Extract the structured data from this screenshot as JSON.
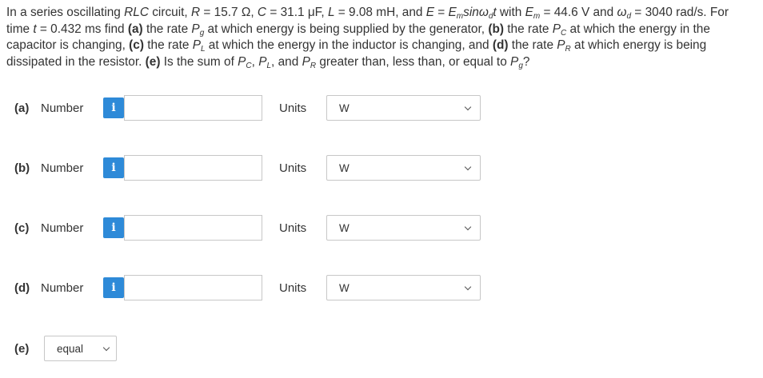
{
  "question": {
    "p1": "In a series oscillating ",
    "rlc": "RLC",
    "p2": " circuit, ",
    "R": "R",
    "p3": " = 15.7 Ω, ",
    "C": "C",
    "p4": " = 31.1 μF, ",
    "L": "L",
    "p5": " = 9.08 mH, and ",
    "E": "E",
    "p6": " = ",
    "Em": "E",
    "Em_sub": "m",
    "sin": "sinω",
    "sin_sub": "d",
    "t1": "t",
    "p7": " with ",
    "Em2": "E",
    "Em2_sub": "m",
    "p8": " = 44.6 V and ",
    "wd": "ω",
    "wd_sub": "d",
    "p9": " = 3040 rad/s. For time ",
    "t2": "t",
    "p10": " = 0.432 ms find ",
    "a": "(a)",
    "p11": " the rate ",
    "Pg": "P",
    "Pg_sub": "g",
    "p12": " at which energy is being supplied by the generator, ",
    "b": "(b)",
    "p13": " the rate ",
    "Pc": "P",
    "Pc_sub": "C",
    "p14": " at which the energy in the capacitor is changing, ",
    "c": "(c)",
    "p15": " the rate ",
    "Pl": "P",
    "Pl_sub": "L",
    "p16": " at which the energy in the inductor is changing, and ",
    "d": "(d)",
    "p17": " the rate ",
    "Pr": "P",
    "Pr_sub": "R",
    "p18": " at which energy is being dissipated in the resistor. ",
    "e": "(e)",
    "p19": " Is the sum of ",
    "Pc2": "P",
    "Pc2_sub": "C",
    "p20": ", ",
    "Pl2": "P",
    "Pl2_sub": "L",
    "p21": ", and ",
    "Pr2": "P",
    "Pr2_sub": "R",
    "p22": " greater than, less than, or equal to ",
    "Pg2": "P",
    "Pg2_sub": "g",
    "p23": "?"
  },
  "parts": [
    {
      "label": "(a)",
      "number_label": "Number",
      "info_icon": "i",
      "value": "",
      "units_label": "Units",
      "units_value": "W"
    },
    {
      "label": "(b)",
      "number_label": "Number",
      "info_icon": "i",
      "value": "",
      "units_label": "Units",
      "units_value": "W"
    },
    {
      "label": "(c)",
      "number_label": "Number",
      "info_icon": "i",
      "value": "",
      "units_label": "Units",
      "units_value": "W"
    },
    {
      "label": "(d)",
      "number_label": "Number",
      "info_icon": "i",
      "value": "",
      "units_label": "Units",
      "units_value": "W"
    }
  ],
  "part_e": {
    "label": "(e)",
    "selected": "equal"
  },
  "colors": {
    "info_button": "#2e8ad8",
    "border": "#c7c7c7"
  }
}
